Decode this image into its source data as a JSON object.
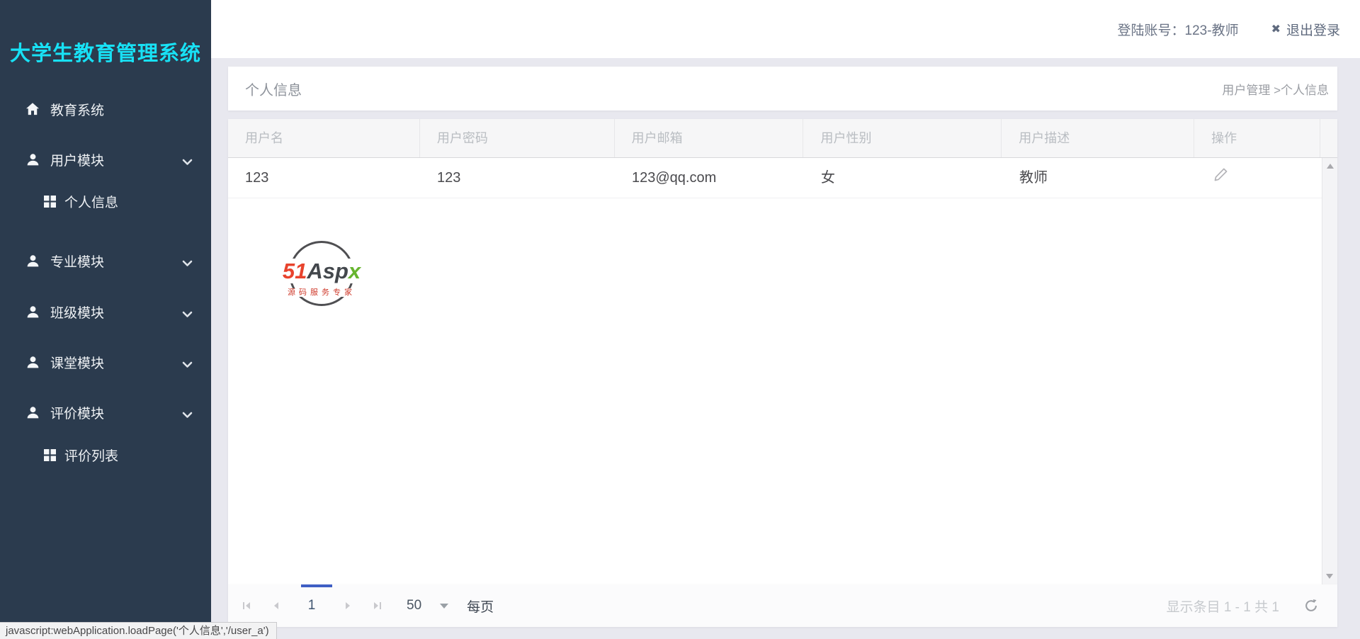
{
  "app": {
    "title": "大学生教育管理系统"
  },
  "topbar": {
    "account_label": "登陆账号：123-教师",
    "logout_icon": "✖",
    "logout_label": "退出登录"
  },
  "sidebar": {
    "items": [
      {
        "label": "教育系统",
        "icon": "home-icon",
        "level": "top",
        "chevron": false
      },
      {
        "label": "用户模块",
        "icon": "user-icon",
        "level": "top",
        "chevron": true
      },
      {
        "label": "个人信息",
        "icon": "grid-icon",
        "level": "sub",
        "chevron": false
      },
      {
        "label": "专业模块",
        "icon": "user-icon",
        "level": "top",
        "chevron": true
      },
      {
        "label": "班级模块",
        "icon": "user-icon",
        "level": "top",
        "chevron": true
      },
      {
        "label": "课堂模块",
        "icon": "user-icon",
        "level": "top",
        "chevron": true
      },
      {
        "label": "评价模块",
        "icon": "user-icon",
        "level": "top",
        "chevron": true
      },
      {
        "label": "评价列表",
        "icon": "grid-icon",
        "level": "sub",
        "chevron": false
      }
    ]
  },
  "breadcrumb": {
    "title": "个人信息",
    "path": "用户管理 >个人信息"
  },
  "table": {
    "columns": [
      "用户名",
      "用户密码",
      "用户邮箱",
      "用户性别",
      "用户描述",
      "操作"
    ],
    "rows": [
      {
        "username": "123",
        "password": "123",
        "email": "123@qq.com",
        "gender": "女",
        "description": "教师"
      }
    ]
  },
  "watermark": {
    "part_51": "51",
    "part_asp": "Asp",
    "part_x": "x",
    "subtitle": "源码服务专家"
  },
  "pagination": {
    "current_page": "1",
    "page_size": "50",
    "per_page_label": "每页",
    "summary": "显示条目 1 - 1 共 1"
  },
  "statusbar": {
    "text": "javascript:webApplication.loadPage('个人信息','/user_a')"
  },
  "colors": {
    "sidebar_bg": "#2b3b4e",
    "brand_cyan": "#18e1f5",
    "accent_blue": "#3f5fc4",
    "logo_red": "#e8432d",
    "logo_green": "#67b52f"
  }
}
